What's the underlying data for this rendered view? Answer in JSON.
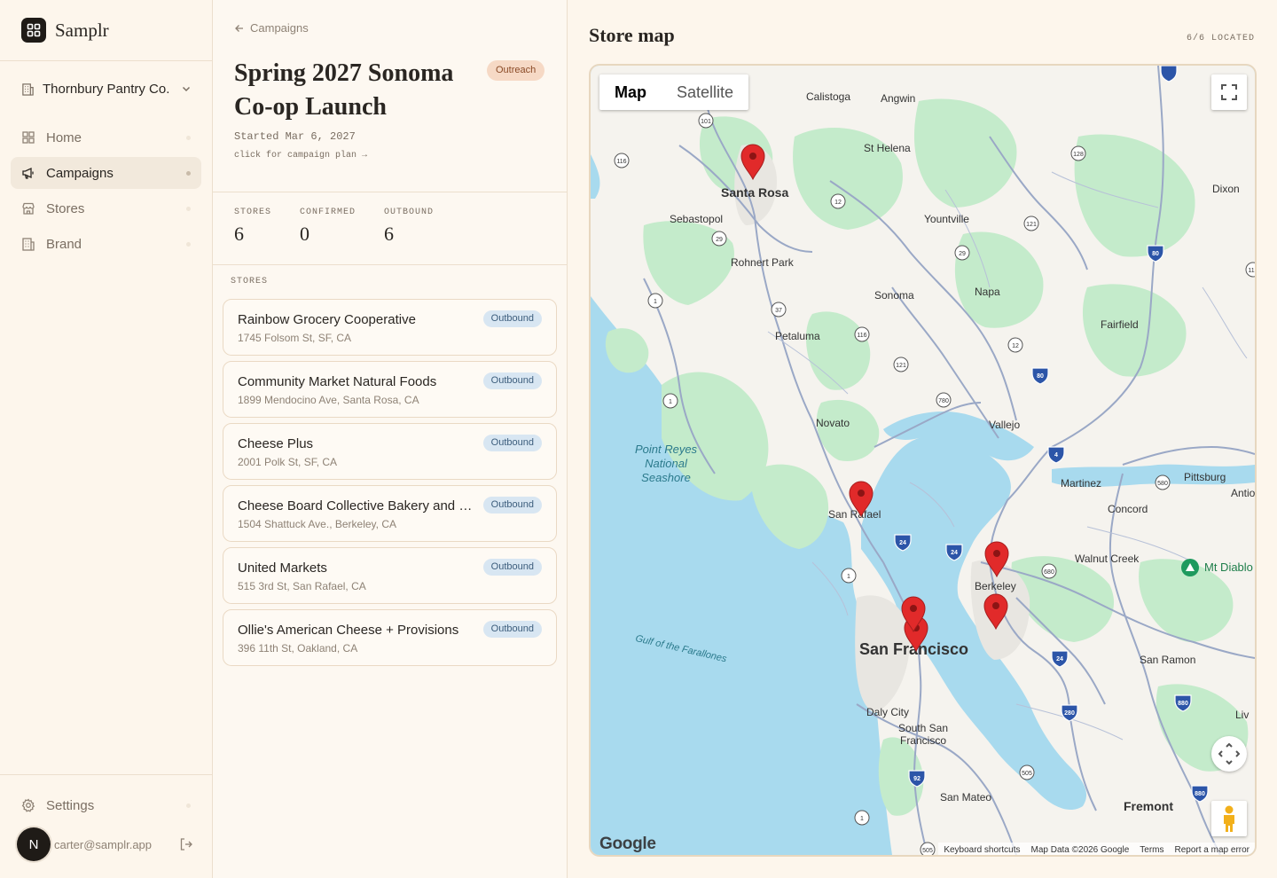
{
  "app": {
    "name": "Samplr"
  },
  "org": {
    "name": "Thornbury Pantry Co."
  },
  "nav": {
    "items": [
      {
        "label": "Home",
        "icon": "grid-icon",
        "active": false
      },
      {
        "label": "Campaigns",
        "icon": "megaphone-icon",
        "active": true
      },
      {
        "label": "Stores",
        "icon": "store-icon",
        "active": false
      },
      {
        "label": "Brand",
        "icon": "building-icon",
        "active": false
      }
    ],
    "settings": "Settings"
  },
  "user": {
    "initial": "N",
    "email": "carter@samplr.app"
  },
  "campaign": {
    "back_label": "Campaigns",
    "title": "Spring 2027 Sonoma Co-op Launch",
    "status": "Outreach",
    "started": "Started Mar 6, 2027",
    "plan_link": "click for campaign plan →",
    "stats": [
      {
        "label": "STORES",
        "value": "6"
      },
      {
        "label": "CONFIRMED",
        "value": "0"
      },
      {
        "label": "OUTBOUND",
        "value": "6"
      }
    ],
    "list_heading": "STORES",
    "stores": [
      {
        "name": "Rainbow Grocery Cooperative",
        "address": "1745 Folsom St, SF, CA",
        "status": "Outbound"
      },
      {
        "name": "Community Market Natural Foods",
        "address": "1899 Mendocino Ave, Santa Rosa, CA",
        "status": "Outbound"
      },
      {
        "name": "Cheese Plus",
        "address": "2001 Polk St, SF, CA",
        "status": "Outbound"
      },
      {
        "name": "Cheese Board Collective Bakery and C...",
        "address": "1504 Shattuck Ave., Berkeley, CA",
        "status": "Outbound"
      },
      {
        "name": "United Markets",
        "address": "515 3rd St, San Rafael, CA",
        "status": "Outbound"
      },
      {
        "name": "Ollie's American Cheese + Provisions",
        "address": "396 11th St, Oakland, CA",
        "status": "Outbound"
      }
    ]
  },
  "map": {
    "title": "Store map",
    "located": "6/6 LOCATED",
    "type_options": [
      "Map",
      "Satellite"
    ],
    "selected_type": "Map",
    "provider": "Google",
    "footer": [
      "Keyboard shortcuts",
      "Map Data ©2026 Google",
      "Terms",
      "Report a map error"
    ],
    "cities_major": [
      "Santa Rosa",
      "San Francisco",
      "Fremont"
    ],
    "cities": [
      "Calistoga",
      "Angwin",
      "St Helena",
      "Dixon",
      "Sebastopol",
      "Yountville",
      "Rohnert Park",
      "Sonoma",
      "Napa",
      "Fairfield",
      "Petaluma",
      "Novato",
      "Vallejo",
      "Martinez",
      "Pittsburg",
      "Antio",
      "Concord",
      "San Rafael",
      "Walnut Creek",
      "Mt Diablo",
      "Berkeley",
      "San Ramon",
      "Daly City",
      "South San Francisco",
      "San Mateo",
      "Liv"
    ],
    "water_labels": [
      "Point Reyes National Seashore",
      "Gulf of the Farallones"
    ],
    "highway_shields": [
      "101",
      "116",
      "128",
      "12",
      "121",
      "29",
      "80",
      "113",
      "1",
      "37",
      "780",
      "4",
      "580",
      "24",
      "680",
      "880",
      "280",
      "92",
      "505"
    ],
    "colors": {
      "water": "#a8daee",
      "land": "#f5f3ee",
      "park": "#c4ebcb",
      "road": "#9aa8c6",
      "marker": "#e12a2a"
    }
  }
}
